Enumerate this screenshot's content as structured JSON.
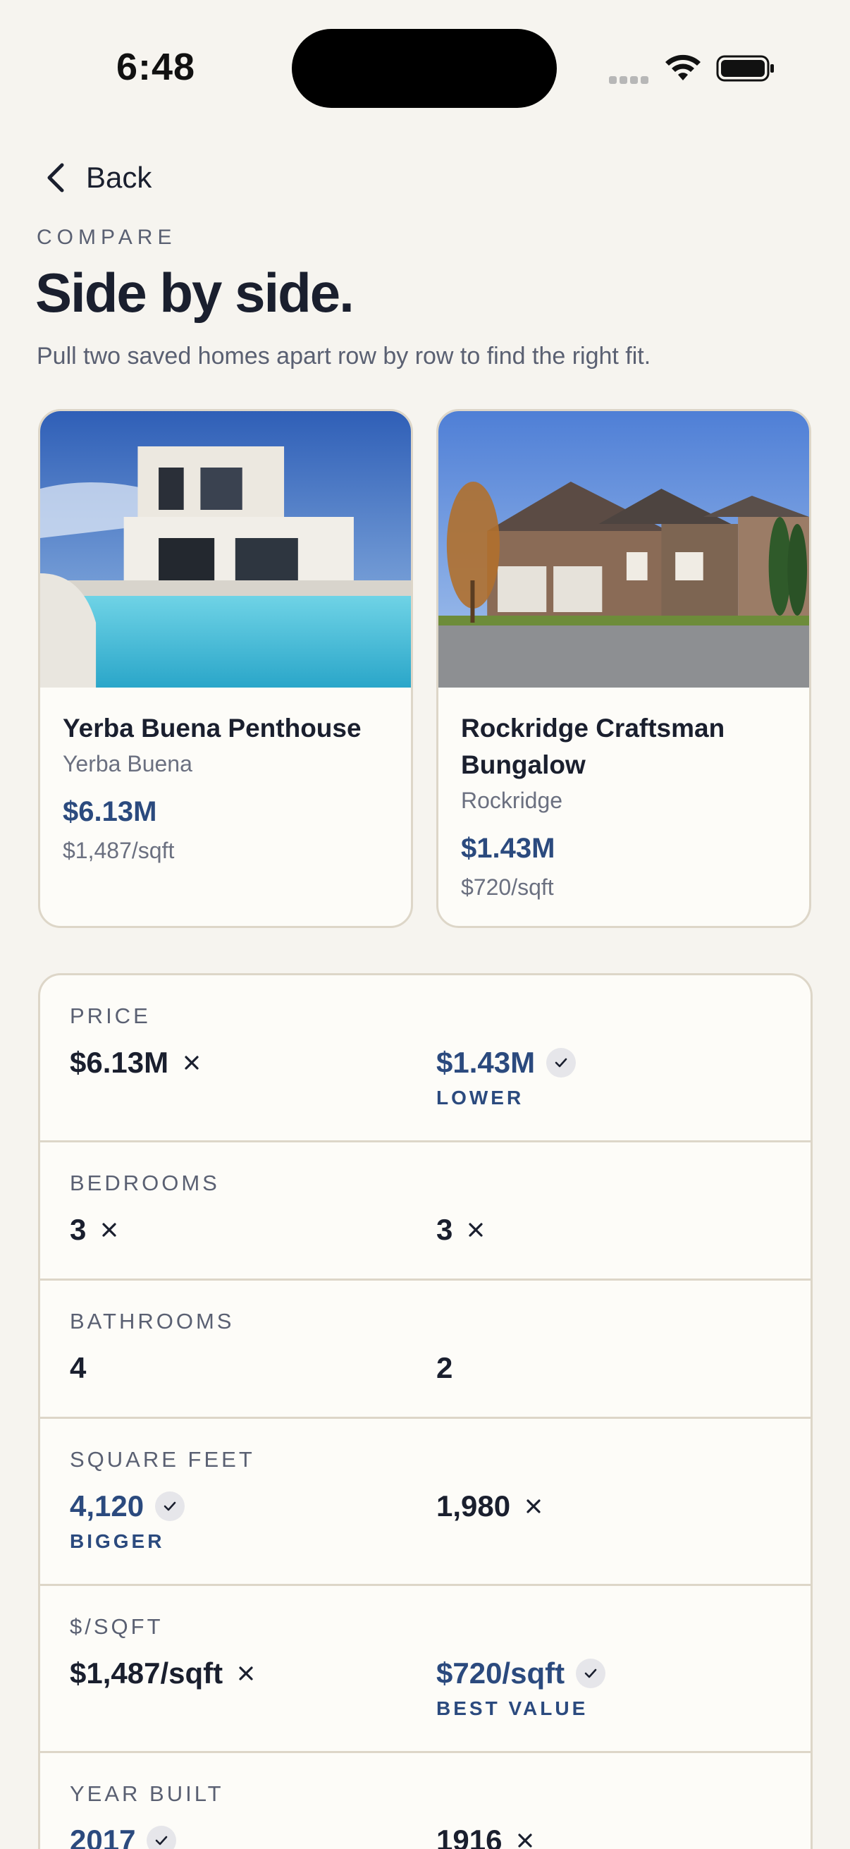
{
  "status": {
    "time": "6:48"
  },
  "nav": {
    "back_label": "Back"
  },
  "header": {
    "eyebrow": "COMPARE",
    "title": "Side by side.",
    "subtitle": "Pull two saved homes apart row by row to find the right fit."
  },
  "homes": [
    {
      "name": "Yerba Buena Penthouse",
      "neighborhood": "Yerba Buena",
      "price": "$6.13M",
      "price_per_sqft": "$1,487/sqft"
    },
    {
      "name": "Rockridge Craftsman Bungalow",
      "neighborhood": "Rockridge",
      "price": "$1.43M",
      "price_per_sqft": "$720/sqft"
    }
  ],
  "compare_rows": [
    {
      "label": "PRICE",
      "a": {
        "value": "$6.13M",
        "winner": false,
        "tag": ""
      },
      "b": {
        "value": "$1.43M",
        "winner": true,
        "tag": "LOWER"
      }
    },
    {
      "label": "BEDROOMS",
      "a": {
        "value": "3",
        "winner": false,
        "tag": ""
      },
      "b": {
        "value": "3",
        "winner": false,
        "tag": ""
      }
    },
    {
      "label": "BATHROOMS",
      "a": {
        "value": "4",
        "winner": null,
        "tag": ""
      },
      "b": {
        "value": "2",
        "winner": null,
        "tag": ""
      }
    },
    {
      "label": "SQUARE FEET",
      "a": {
        "value": "4,120",
        "winner": true,
        "tag": "BIGGER"
      },
      "b": {
        "value": "1,980",
        "winner": false,
        "tag": ""
      }
    },
    {
      "label": "$/SQFT",
      "a": {
        "value": "$1,487/sqft",
        "winner": false,
        "tag": ""
      },
      "b": {
        "value": "$720/sqft",
        "winner": true,
        "tag": "BEST VALUE"
      }
    },
    {
      "label": "YEAR BUILT",
      "a": {
        "value": "2017",
        "winner": true,
        "tag": ""
      },
      "b": {
        "value": "1916",
        "winner": false,
        "tag": ""
      }
    }
  ],
  "colors": {
    "accent": "#2b4a7e",
    "background": "#f6f4ef",
    "card": "#fdfcf8",
    "border": "#ddd6c8"
  },
  "icons": {
    "back": "chevron-left-icon",
    "winner": "check-icon",
    "loser": "x-icon"
  }
}
